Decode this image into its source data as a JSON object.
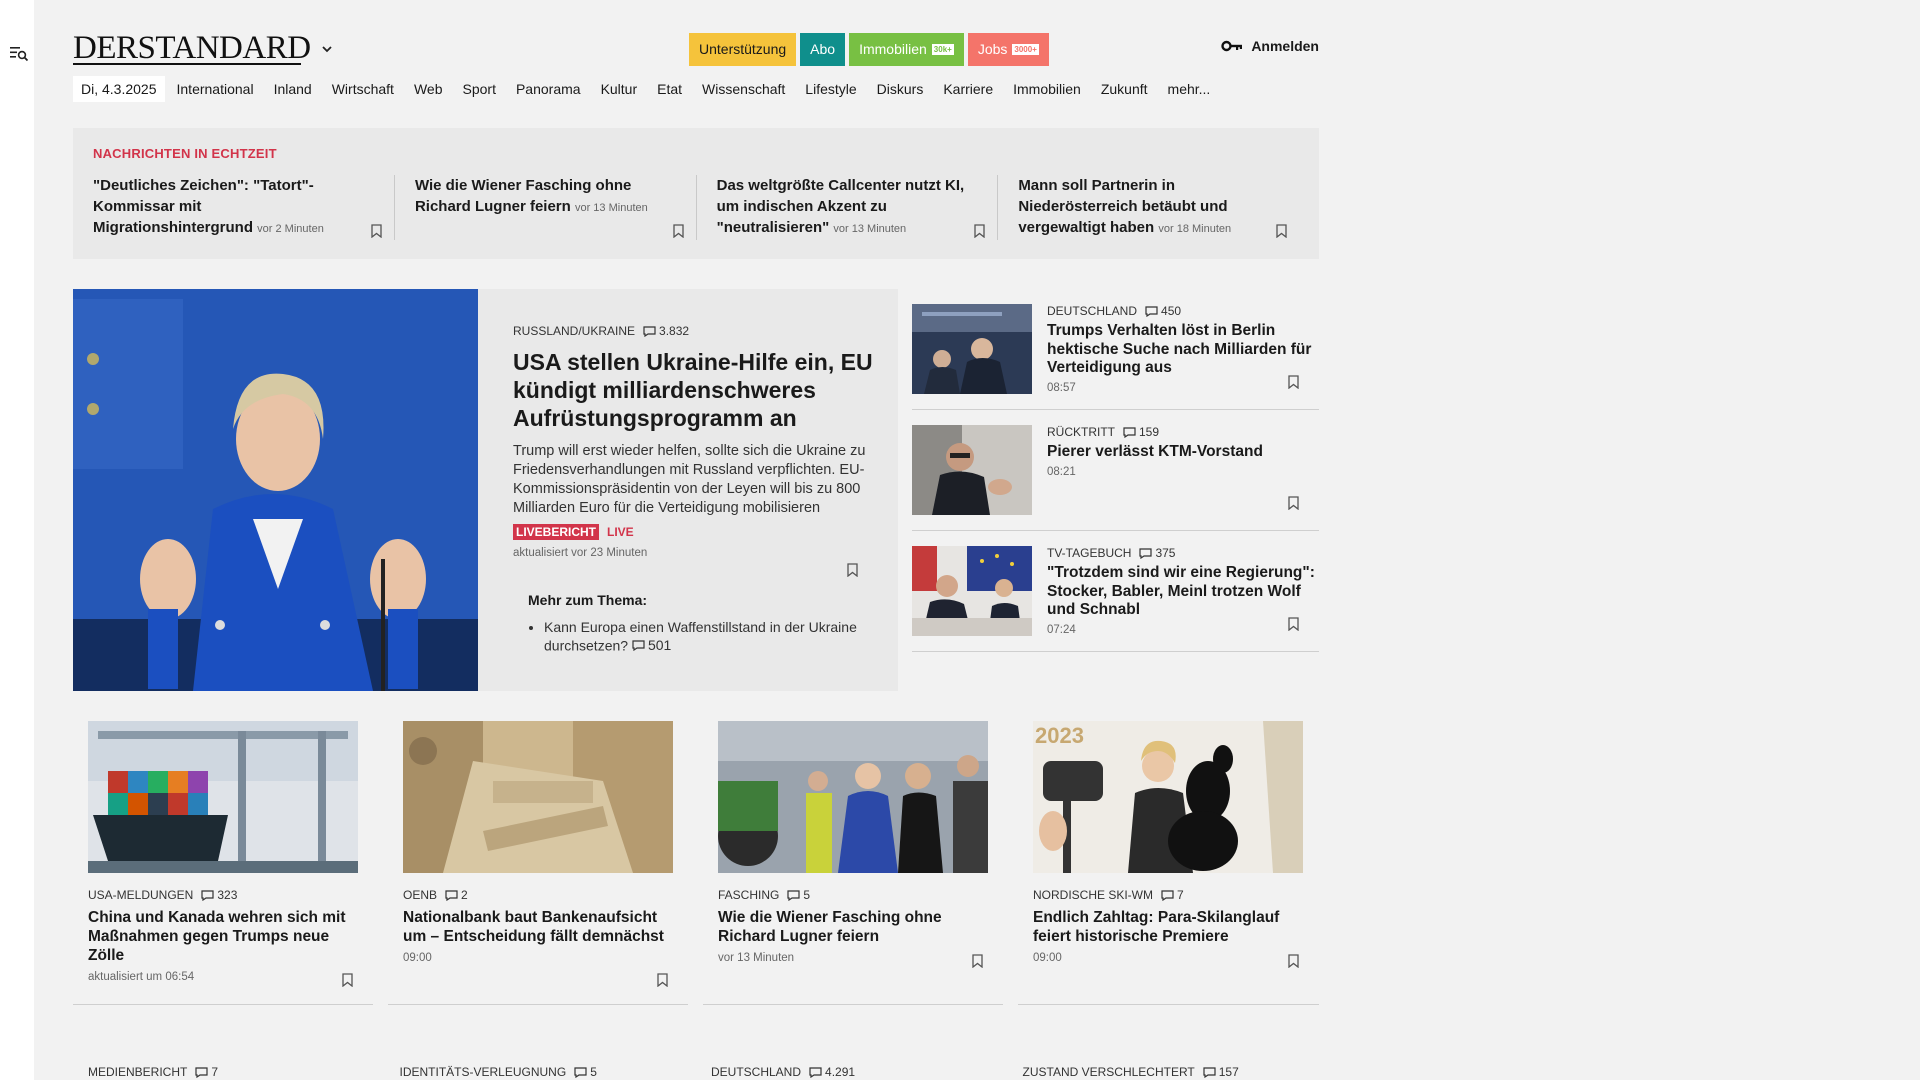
{
  "brand": {
    "logo": "DERSTANDARD"
  },
  "header": {
    "pills": [
      {
        "label": "Unterstützung",
        "bg": "#f5c33b",
        "fg": "#1a1a1a",
        "tag": ""
      },
      {
        "label": "Abo",
        "bg": "#0f8f8c",
        "fg": "#ffffff",
        "tag": ""
      },
      {
        "label": "Immobilien",
        "bg": "#78c043",
        "fg": "#ffffff",
        "tag": "30k+"
      },
      {
        "label": "Jobs",
        "bg": "#f4746a",
        "fg": "#ffffff",
        "tag": "3000+"
      }
    ],
    "login": "Anmelden"
  },
  "nav": {
    "date": "Di, 4.3.2025",
    "items": [
      "International",
      "Inland",
      "Wirtschaft",
      "Web",
      "Sport",
      "Panorama",
      "Kultur",
      "Etat",
      "Wissenschaft",
      "Lifestyle",
      "Diskurs",
      "Karriere",
      "Immobilien",
      "Zukunft",
      "mehr..."
    ]
  },
  "ticker": {
    "title": "NACHRICHTEN IN ECHTZEIT",
    "items": [
      {
        "title": "\"Deutliches Zeichen\": \"Tatort\"-Kommissar mit Migrationshintergrund",
        "ago": "vor 2 Minuten"
      },
      {
        "title": "Wie die Wiener Fasching ohne Richard Lugner feiern",
        "ago": "vor 13 Minuten"
      },
      {
        "title": "Das weltgrößte Callcenter nutzt KI, um indischen Akzent zu \"neutralisieren\"",
        "ago": "vor 13 Minuten"
      },
      {
        "title": "Mann soll Partnerin in Niederösterreich betäubt und vergewaltigt haben",
        "ago": "vor 18 Minuten"
      }
    ]
  },
  "hero": {
    "kicker": "RUSSLAND/UKRAINE",
    "comments": "3.832",
    "title": "USA stellen Ukraine-Hilfe ein, EU kündigt milliardenschweres Aufrüstungsprogramm an",
    "lead": "Trump will erst wieder helfen, sollte sich die Ukraine zu Friedensverhandlungen mit Russland verpflichten. EU-Kommissionspräsidentin von der Leyen will bis zu 800 Milliarden Euro für die Verteidigung mobilisieren",
    "live_badge": "LIVEBERICHT",
    "live_word": "LIVE",
    "updated": "aktualisiert vor 23 Minuten",
    "more_title": "Mehr zum Thema:",
    "more_items": [
      {
        "text": "Kann Europa einen Waffenstillstand in der Ukraine durchsetzen?",
        "comments": "501"
      }
    ]
  },
  "side": [
    {
      "kicker": "DEUTSCHLAND",
      "comments": "450",
      "title": "Trumps Verhalten löst in Berlin hektische Suche nach Milliarden für Verteidigung aus",
      "time": "08:57"
    },
    {
      "kicker": "RÜCKTRITT",
      "comments": "159",
      "title": "Pierer verlässt KTM-Vorstand",
      "time": "08:21"
    },
    {
      "kicker": "TV-TAGEBUCH",
      "comments": "375",
      "title": "\"Trotzdem sind wir eine Regierung\": Stocker, Babler, Meinl trotzen Wolf und Schnabl",
      "time": "07:24"
    }
  ],
  "cards": [
    {
      "kicker": "USA-MELDUNGEN",
      "comments": "323",
      "title": "China und Kanada wehren sich mit Maßnahmen gegen Trumps neue Zölle",
      "time": "aktualisiert um 06:54"
    },
    {
      "kicker": "OENB",
      "comments": "2",
      "title": "Nationalbank baut Bankenaufsicht um – Entscheidung fällt demnächst",
      "time": "09:00"
    },
    {
      "kicker": "FASCHING",
      "comments": "5",
      "title": "Wie die Wiener Fasching ohne Richard Lugner feiern",
      "time": "vor 13 Minuten"
    },
    {
      "kicker": "NORDISCHE SKI-WM",
      "comments": "7",
      "title": "Endlich Zahltag: Para-Skilanglauf feiert historische Premiere",
      "time": "09:00"
    }
  ],
  "row2": [
    {
      "kicker": "MEDIENBERICHT",
      "comments": "7"
    },
    {
      "kicker": "IDENTITÄTS-VERLEUGNUNG",
      "comments": "5"
    },
    {
      "kicker": "DEUTSCHLAND",
      "comments": "4.291"
    },
    {
      "kicker": "ZUSTAND VERSCHLECHTERT",
      "comments": "157"
    }
  ],
  "images": {
    "card4_year": "2023"
  }
}
